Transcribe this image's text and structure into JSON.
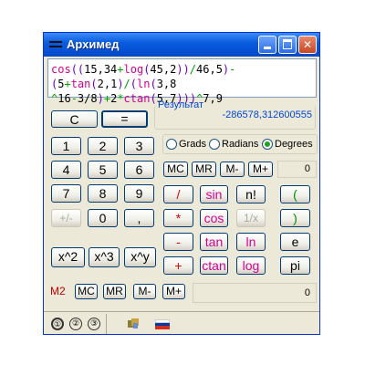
{
  "window": {
    "title": "Архимед"
  },
  "expression": {
    "line1": [
      {
        "t": "cos",
        "c": "fn"
      },
      {
        "t": "((",
        "c": "br"
      },
      {
        "t": "15,34",
        "c": ""
      },
      {
        "t": "+",
        "c": "op"
      },
      {
        "t": "log",
        "c": "fn"
      },
      {
        "t": "(",
        "c": "br"
      },
      {
        "t": "45,2",
        "c": ""
      },
      {
        "t": "))",
        "c": "br"
      },
      {
        "t": "/",
        "c": "op"
      },
      {
        "t": "46,5",
        "c": ""
      },
      {
        "t": ")",
        "c": "br"
      },
      {
        "t": "-",
        "c": "op"
      },
      {
        "t": "(",
        "c": "br"
      },
      {
        "t": "5",
        "c": ""
      },
      {
        "t": "+",
        "c": "op"
      },
      {
        "t": "tan",
        "c": "fn"
      },
      {
        "t": "(",
        "c": "br"
      },
      {
        "t": "2,1",
        "c": ""
      },
      {
        "t": ")",
        "c": "br"
      },
      {
        "t": "/",
        "c": "op"
      },
      {
        "t": "(",
        "c": "br"
      },
      {
        "t": "ln",
        "c": "fn"
      },
      {
        "t": "(",
        "c": "br"
      },
      {
        "t": "3,8",
        "c": ""
      }
    ],
    "line2": [
      {
        "t": "^",
        "c": "op"
      },
      {
        "t": "16",
        "c": ""
      },
      {
        "t": "-",
        "c": "op"
      },
      {
        "t": "3/8",
        "c": ""
      },
      {
        "t": ")",
        "c": "br"
      },
      {
        "t": "+",
        "c": "op"
      },
      {
        "t": "2",
        "c": ""
      },
      {
        "t": "*",
        "c": "op"
      },
      {
        "t": "ctan",
        "c": "fn"
      },
      {
        "t": "(",
        "c": "br"
      },
      {
        "t": "5,7",
        "c": ""
      },
      {
        "t": ")))",
        "c": "br"
      },
      {
        "t": "^",
        "c": "op"
      },
      {
        "t": "7,9",
        "c": ""
      }
    ]
  },
  "result": {
    "label": "Результат",
    "value": "-286578,312600555"
  },
  "keys": {
    "c": "C",
    "eq": "=",
    "d1": "1",
    "d2": "2",
    "d3": "3",
    "d4": "4",
    "d5": "5",
    "d6": "6",
    "d7": "7",
    "d8": "8",
    "d9": "9",
    "d0": "0",
    "sign": "+/-",
    "dot": ",",
    "sq": "x^2",
    "cube": "x^3",
    "pow": "x^y",
    "div": "/",
    "mul": "*",
    "sub": "-",
    "add": "+",
    "sin": "sin",
    "cos": "cos",
    "tan": "tan",
    "ctan": "ctan",
    "fact": "n!",
    "inv": "1/x",
    "ln": "ln",
    "log": "log",
    "lpar": "(",
    "rpar": ")",
    "e": "e",
    "pi": "pi"
  },
  "angle": {
    "options": [
      "Grads",
      "Radians",
      "Degrees"
    ],
    "selected": "Degrees"
  },
  "memory1": {
    "buttons": [
      "MC",
      "MR",
      "M-",
      "M+"
    ],
    "value": "0"
  },
  "memory2": {
    "label": "M2",
    "buttons": [
      "MC",
      "MR",
      "M-",
      "M+"
    ],
    "value": "0"
  },
  "status": {
    "modes": [
      "①",
      "②",
      "③"
    ],
    "tools_icon": "puzzle-icon",
    "language_flag": "russian-flag-icon"
  },
  "colors": {
    "titlebar": "#0a5ddf",
    "function": "#d40090",
    "operator": "#00a000",
    "bracket": "#6a00c0",
    "digit_dim": "#aca899"
  }
}
